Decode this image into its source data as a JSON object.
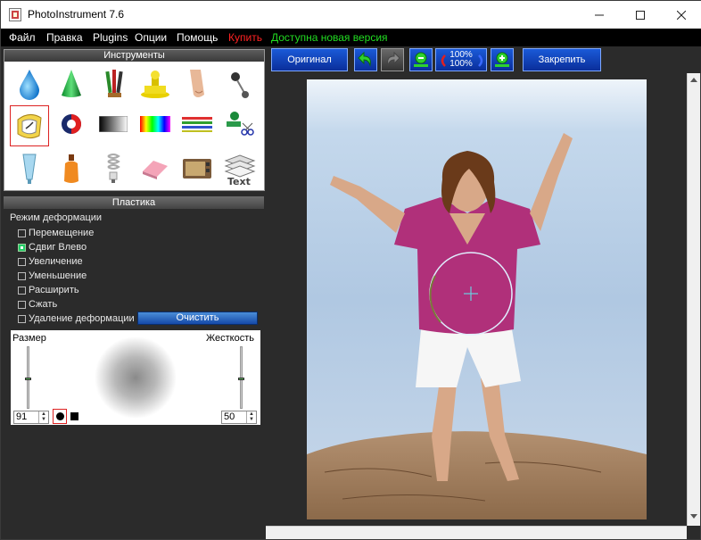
{
  "app": {
    "title": "PhotoInstrument 7.6"
  },
  "menu": {
    "items": [
      "Файл",
      "Правка",
      "Plugins",
      "Опции",
      "Помощь"
    ],
    "buy": "Купить",
    "update": "Доступна новая версия",
    "buy_color": "#ff2222",
    "update_color": "#22dd22"
  },
  "tools_panel": {
    "title": "Инструменты",
    "tools": [
      {
        "icon": "drop-icon"
      },
      {
        "icon": "cone-icon"
      },
      {
        "icon": "brushes-icon"
      },
      {
        "icon": "stamp-icon"
      },
      {
        "icon": "finger-icon"
      },
      {
        "icon": "pin-icon"
      },
      {
        "icon": "deform-icon",
        "selected": true
      },
      {
        "icon": "color-circle-icon"
      },
      {
        "icon": "gradient-icon"
      },
      {
        "icon": "spectrum-icon"
      },
      {
        "icon": "lines-icon"
      },
      {
        "icon": "scissors-icon"
      },
      {
        "icon": "tube-icon"
      },
      {
        "icon": "bottle-icon"
      },
      {
        "icon": "bulb-icon"
      },
      {
        "icon": "eraser-icon"
      },
      {
        "icon": "tv-icon"
      },
      {
        "icon": "text-layers-icon",
        "text": "Text"
      }
    ]
  },
  "deform_panel": {
    "title": "Пластика",
    "mode_label": "Режим деформации",
    "options": [
      {
        "label": "Перемещение",
        "checked": false
      },
      {
        "label": "Сдвиг Влево",
        "checked": true
      },
      {
        "label": "Увеличение",
        "checked": false
      },
      {
        "label": "Уменьшение",
        "checked": false
      },
      {
        "label": "Расширить",
        "checked": false
      },
      {
        "label": "Сжать",
        "checked": false
      },
      {
        "label": "Удаление деформации",
        "checked": false
      }
    ],
    "clear_button": "Очистить",
    "size_label": "Размер",
    "hardness_label": "Жесткость",
    "size_value": "91",
    "hardness_value": "50",
    "size_level": 0.47,
    "hardness_level": 0.47
  },
  "toolbar": {
    "original": "Оригинал",
    "zoom_top": "100%",
    "zoom_bottom": "100%",
    "commit": "Закрепить"
  }
}
